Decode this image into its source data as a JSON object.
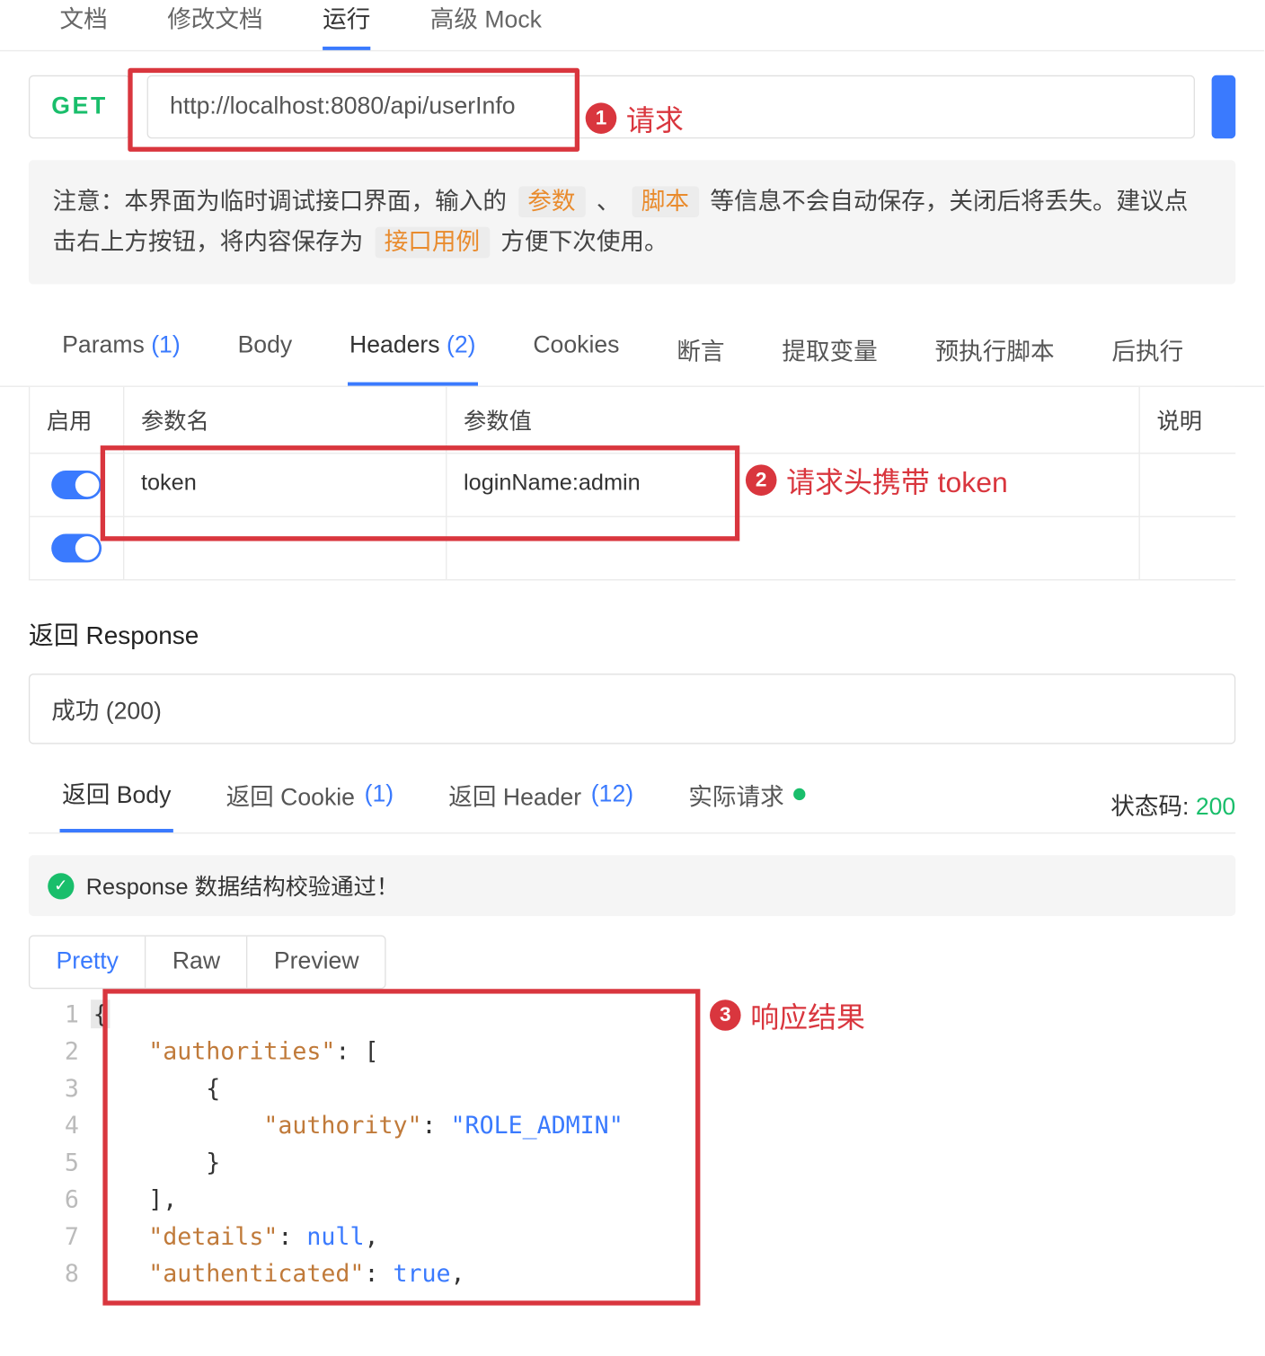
{
  "top_tabs": {
    "doc": "文档",
    "edit_doc": "修改文档",
    "run": "运行",
    "mock": "高级 Mock"
  },
  "request": {
    "method": "GET",
    "url": "http://localhost:8080/api/userInfo",
    "anno_label": "请求"
  },
  "notice": {
    "prefix": "注意：本界面为临时调试接口界面，输入的 ",
    "tag_param": "参数",
    "sep1": " 、",
    "tag_script": "脚本",
    "mid": " 等信息不会自动保存，关闭后将丢失。建议点击右上方按钮，将内容保存为 ",
    "tag_case": "接口用例",
    "suffix": " 方便下次使用。"
  },
  "sub_tabs": {
    "params": "Params ",
    "params_count": "(1)",
    "body": "Body",
    "headers": "Headers ",
    "headers_count": "(2)",
    "cookies": "Cookies",
    "assert": "断言",
    "extract": "提取变量",
    "prescript": "预执行脚本",
    "postscript": "后执行"
  },
  "table": {
    "head": {
      "enable": "启用",
      "name": "参数名",
      "value": "参数值",
      "desc": "说明"
    },
    "rows": [
      {
        "name": "token",
        "value": "loginName:admin"
      },
      {
        "name": "",
        "value": ""
      }
    ],
    "anno_label": "请求头携带 token"
  },
  "response": {
    "title": "返回 Response",
    "status_box": "成功 (200)",
    "tabs": {
      "body": "返回 Body",
      "cookie": "返回 Cookie ",
      "cookie_count": "(1)",
      "header": "返回 Header ",
      "header_count": "(12)",
      "actual": "实际请求"
    },
    "status_label": "状态码: ",
    "status_code": "200",
    "validate_msg": "Response 数据结构校验通过！",
    "view_tabs": {
      "pretty": "Pretty",
      "raw": "Raw",
      "preview": "Preview"
    },
    "anno_label": "响应结果",
    "json_lines": {
      "l1": "{",
      "l2_key": "\"authorities\"",
      "l2_after": ": [",
      "l3": "{",
      "l4_key": "\"authority\"",
      "l4_val": "\"ROLE_ADMIN\"",
      "l5": "}",
      "l6": "],",
      "l7_key": "\"details\"",
      "l7_val": "null",
      "l7_after": ",",
      "l8_key": "\"authenticated\"",
      "l8_val": "true",
      "l8_after": ","
    }
  },
  "anno_numbers": {
    "one": "1",
    "two": "2",
    "three": "3"
  },
  "line_numbers": [
    "1",
    "2",
    "3",
    "4",
    "5",
    "6",
    "7",
    "8"
  ]
}
